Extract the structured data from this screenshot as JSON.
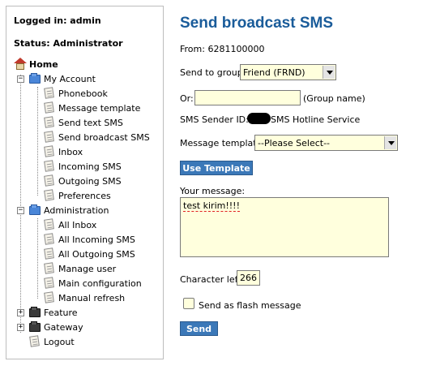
{
  "sidebar": {
    "logged_in": "Logged in: admin",
    "status": "Status: Administrator",
    "home": "Home",
    "my_account": {
      "label": "My Account",
      "items": [
        "Phonebook",
        "Message template",
        "Send text SMS",
        "Send broadcast SMS",
        "Inbox",
        "Incoming SMS",
        "Outgoing SMS",
        "Preferences"
      ]
    },
    "administration": {
      "label": "Administration",
      "items": [
        "All Inbox",
        "All Incoming SMS",
        "All Outgoing SMS",
        "Manage user",
        "Main configuration",
        "Manual refresh"
      ]
    },
    "feature": "Feature",
    "gateway": "Gateway",
    "logout": "Logout"
  },
  "main": {
    "title": "Send broadcast SMS",
    "from": "From: 6281100000",
    "send_to_group_label": "Send to group:",
    "group_selected": "Friend (FRND)",
    "or_label": "Or:",
    "group_name_value": "",
    "group_name_hint": "(Group name)",
    "sender_id_label": "SMS Sender ID: -",
    "sender_id_suffix": "SMS Hotline Service",
    "message_template_label": "Message template:",
    "template_selected": "--Please Select--",
    "use_template_button": "Use Template",
    "your_message_label": "Your message:",
    "message_text": "test kirim!!!!",
    "character_left_label": "Character left:",
    "character_left_value": "266",
    "flash_label": "Send as flash message",
    "send_button": "Send"
  }
}
